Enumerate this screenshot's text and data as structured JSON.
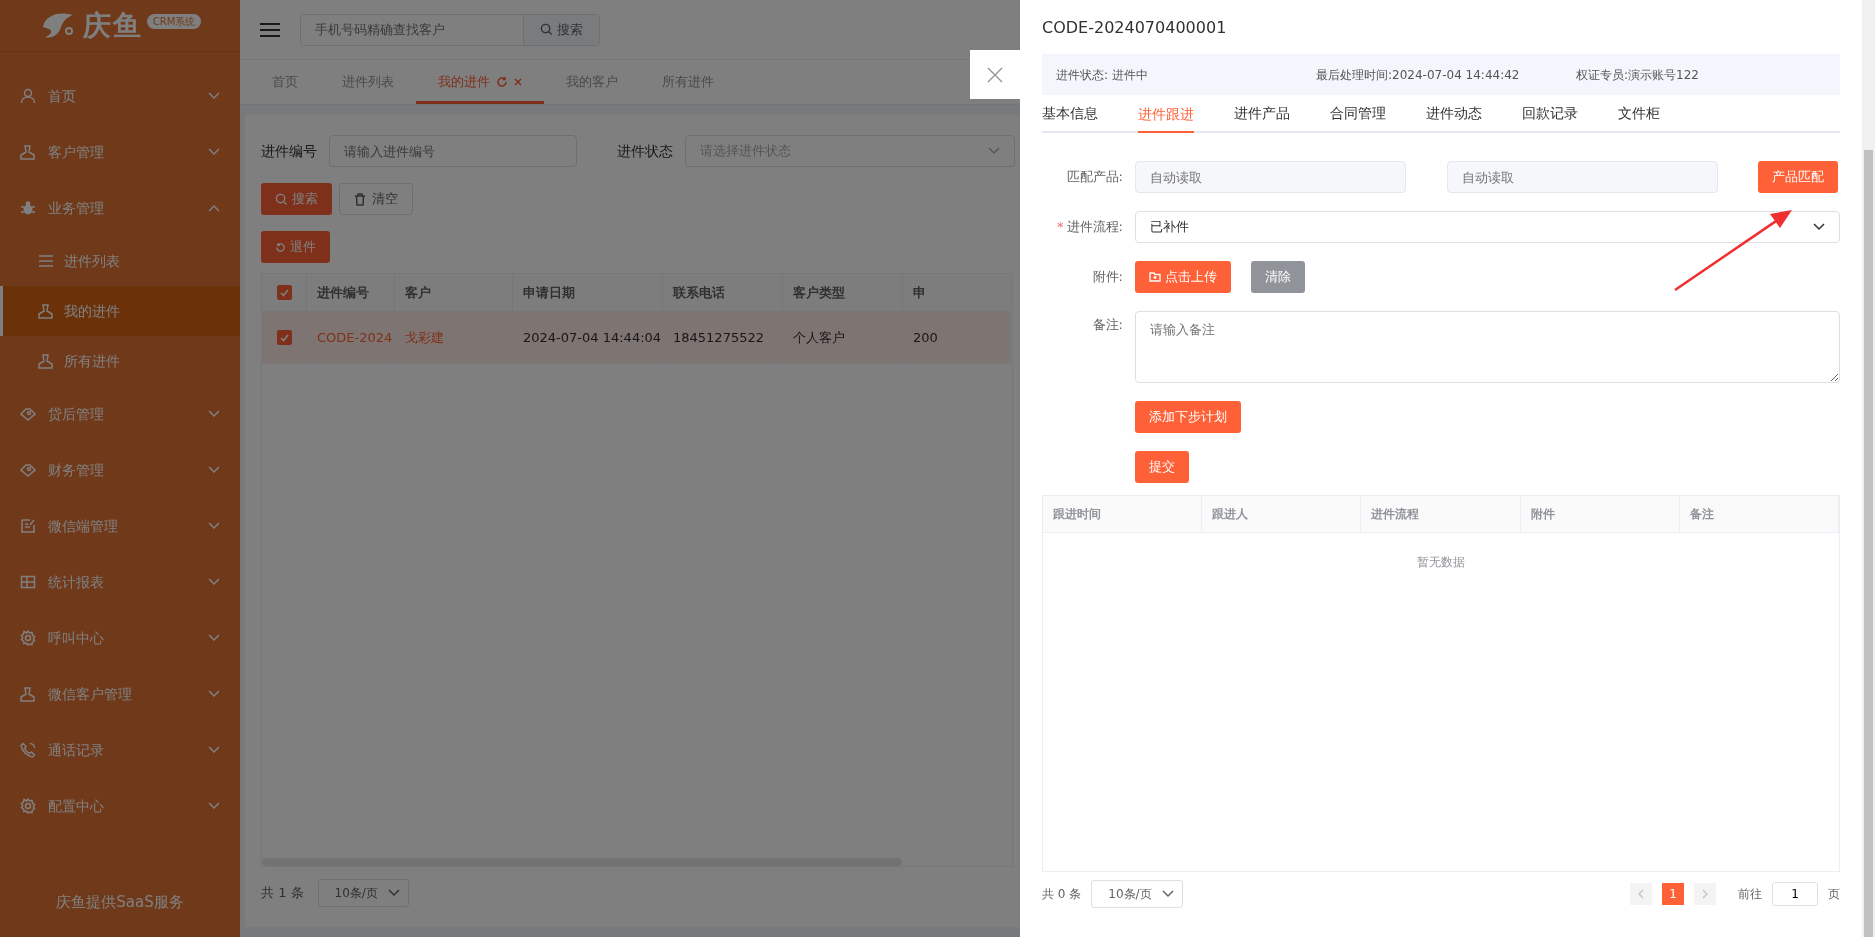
{
  "sidebar": {
    "logo": {
      "brand": "庆鱼",
      "badge": "CRM系统"
    },
    "items": [
      {
        "label": "首页",
        "expanded": false
      },
      {
        "label": "客户管理",
        "expanded": false
      },
      {
        "label": "业务管理",
        "expanded": true,
        "children": [
          {
            "label": "进件列表",
            "selected": false
          },
          {
            "label": "我的进件",
            "selected": true
          },
          {
            "label": "所有进件",
            "selected": false
          }
        ]
      },
      {
        "label": "贷后管理",
        "expanded": false
      },
      {
        "label": "财务管理",
        "expanded": false
      },
      {
        "label": "微信端管理",
        "expanded": false
      },
      {
        "label": "统计报表",
        "expanded": false
      },
      {
        "label": "呼叫中心",
        "expanded": false
      },
      {
        "label": "微信客户管理",
        "expanded": false
      },
      {
        "label": "通话记录",
        "expanded": false
      },
      {
        "label": "配置中心",
        "expanded": false
      }
    ],
    "footer": "庆鱼提供SaaS服务"
  },
  "topbar": {
    "search": {
      "placeholder": "手机号码精确查找客户",
      "button": "搜索"
    }
  },
  "tabs": [
    {
      "label": "首页",
      "selected": false
    },
    {
      "label": "进件列表",
      "selected": false
    },
    {
      "label": "我的进件",
      "selected": true
    },
    {
      "label": "我的客户",
      "selected": false
    },
    {
      "label": "所有进件",
      "selected": false
    }
  ],
  "filters": [
    {
      "label": "进件编号",
      "placeholder": "请输入进件编号",
      "kind": "input"
    },
    {
      "label": "进件状态",
      "placeholder": "请选择进件状态",
      "kind": "select"
    }
  ],
  "filter_buttons": [
    {
      "label": "搜索",
      "kind": "primary"
    },
    {
      "label": "清空",
      "kind": "plain"
    }
  ],
  "action_button": "退件",
  "table": {
    "all_checked": true,
    "columns": [
      "进件编号",
      "客户",
      "申请日期",
      "联系电话",
      "客户类型",
      "申"
    ],
    "rows": [
      {
        "checked": true,
        "selected": true,
        "cells": [
          "CODE-2024",
          "戈彩建",
          "2024-07-04 14:44:04",
          "18451275522",
          "个人客户",
          "200"
        ]
      }
    ]
  },
  "pager": {
    "total": "共 1 条",
    "page_size": "10条/页"
  },
  "drawer": {
    "title": "CODE-2024070400001",
    "info": [
      "进件状态: 进件中",
      "最后处理时间:2024-07-04 14:44:42",
      "权证专员:演示账号122"
    ],
    "tabs": [
      {
        "label": "基本信息",
        "selected": false
      },
      {
        "label": "进件跟进",
        "selected": true
      },
      {
        "label": "进件产品",
        "selected": false
      },
      {
        "label": "合同管理",
        "selected": false
      },
      {
        "label": "进件动态",
        "selected": false
      },
      {
        "label": "回款记录",
        "selected": false
      },
      {
        "label": "文件柜",
        "selected": false
      }
    ],
    "form": {
      "match": {
        "label": "匹配产品:",
        "fields": [
          {
            "placeholder": "自动读取"
          },
          {
            "placeholder": "自动读取"
          }
        ],
        "button": "产品匹配"
      },
      "process": {
        "mark": "*",
        "label": "进件流程:",
        "value": "已补件"
      },
      "attachment": {
        "label": "附件:",
        "upload": "点击上传",
        "clear": "清除"
      },
      "remark": {
        "label": "备注:",
        "placeholder": "请输入备注"
      },
      "buttons": [
        "添加下步计划",
        "提交"
      ]
    },
    "table": {
      "columns": [
        "跟进时间",
        "跟进人",
        "进件流程",
        "附件",
        "备注"
      ],
      "empty": "暂无数据"
    },
    "pager": {
      "total": "共 0 条",
      "page_size": "10条/页",
      "pages": [
        {
          "label": "1",
          "selected": true
        }
      ],
      "goto": "前往",
      "goto_value": "1",
      "suffix": "页"
    }
  }
}
